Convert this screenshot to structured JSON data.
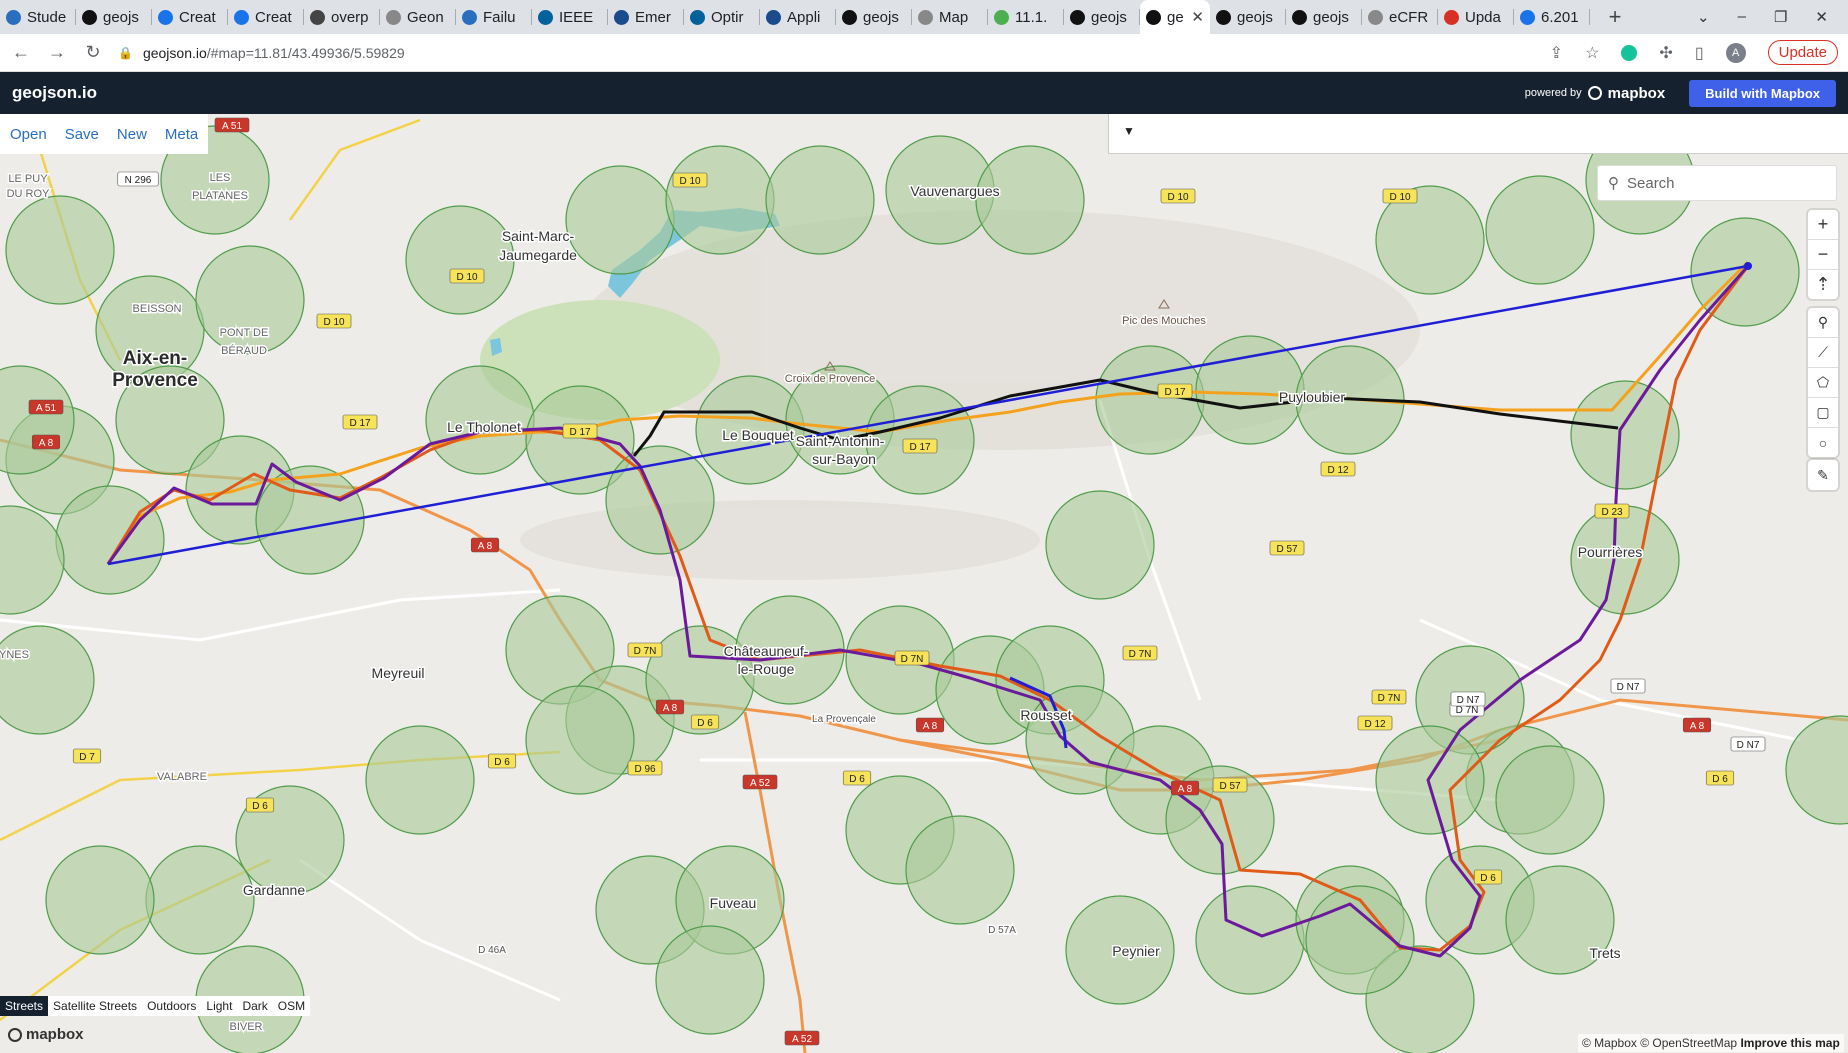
{
  "tabs": [
    {
      "label": "Stude",
      "icon": "app-icon",
      "color": "#2a6ec0"
    },
    {
      "label": "geojs",
      "icon": "geojson-icon",
      "color": "#111"
    },
    {
      "label": "Creat",
      "icon": "docs-icon",
      "color": "#1a73e8"
    },
    {
      "label": "Creat",
      "icon": "docs-icon",
      "color": "#1a73e8"
    },
    {
      "label": "overp",
      "icon": "overpass-icon",
      "color": "#444"
    },
    {
      "label": "Geon",
      "icon": "globe-icon",
      "color": "#888"
    },
    {
      "label": "Failu",
      "icon": "mail-icon",
      "color": "#2a6ec0"
    },
    {
      "label": "IEEE",
      "icon": "ieee-icon",
      "color": "#00629b"
    },
    {
      "label": "Emer",
      "icon": "emergency-icon",
      "color": "#1a4b8c"
    },
    {
      "label": "Optir",
      "icon": "ieee-icon",
      "color": "#00629b"
    },
    {
      "label": "Appli",
      "icon": "emergency-icon",
      "color": "#1a4b8c"
    },
    {
      "label": "geojs",
      "icon": "geojson-icon",
      "color": "#111"
    },
    {
      "label": "Map",
      "icon": "globe-icon",
      "color": "#888"
    },
    {
      "label": "11.1.",
      "icon": "qgis-icon",
      "color": "#4caf50"
    },
    {
      "label": "geojs",
      "icon": "geojson-icon",
      "color": "#111"
    },
    {
      "label": "ge",
      "icon": "geojson-icon",
      "color": "#111",
      "active": true
    },
    {
      "label": "geojs",
      "icon": "geojson-icon",
      "color": "#111"
    },
    {
      "label": "geojs",
      "icon": "geojson-icon",
      "color": "#111"
    },
    {
      "label": "eCFR",
      "icon": "globe-icon",
      "color": "#888"
    },
    {
      "label": "Upda",
      "icon": "gmail-icon",
      "color": "#d93025"
    },
    {
      "label": "6.201",
      "icon": "doc-icon",
      "color": "#1a73e8"
    }
  ],
  "browser": {
    "url_host": "geojson.io",
    "url_path": "/#map=11.81/43.49936/5.59829",
    "update_label": "Update",
    "avatar_letter": "A"
  },
  "app": {
    "brand": "geojson.io",
    "powered_by": "powered by",
    "mapbox": "mapbox",
    "build_button": "Build with Mapbox"
  },
  "menu": {
    "open": "Open",
    "save": "Save",
    "new": "New",
    "meta": "Meta"
  },
  "search": {
    "placeholder": "Search"
  },
  "layers": [
    "Streets",
    "Satellite Streets",
    "Outdoors",
    "Light",
    "Dark",
    "OSM"
  ],
  "selected_layer": "Streets",
  "attribution": {
    "mapbox": "© Mapbox",
    "osm": "© OpenStreetMap",
    "improve": "Improve this map"
  },
  "map_labels": [
    {
      "text": "Aix-en-",
      "cls": "city"
    },
    {
      "text": "Provence",
      "cls": "city"
    },
    {
      "text": "Saint-Marc-",
      "cls": "town"
    },
    {
      "text": "Jaumegarde",
      "cls": "town"
    },
    {
      "text": "Vauvenargues",
      "cls": "town"
    },
    {
      "text": "Le Tholonet",
      "cls": "town"
    },
    {
      "text": "Le Bouquet",
      "cls": "town"
    },
    {
      "text": "Saint-Antonin-",
      "cls": "town"
    },
    {
      "text": "sur-Bayon",
      "cls": "town"
    },
    {
      "text": "Puyloubier",
      "cls": "town"
    },
    {
      "text": "Pic des Mouches",
      "cls": "poi"
    },
    {
      "text": "Croix de Provence",
      "cls": "poi"
    },
    {
      "text": "Meyreuil",
      "cls": "town"
    },
    {
      "text": "Châteauneuf-",
      "cls": "town"
    },
    {
      "text": "le-Rouge",
      "cls": "town"
    },
    {
      "text": "Rousset",
      "cls": "town"
    },
    {
      "text": "Pourrières",
      "cls": "town"
    },
    {
      "text": "Gardanne",
      "cls": "town"
    },
    {
      "text": "Fuveau",
      "cls": "town"
    },
    {
      "text": "Peynier",
      "cls": "town"
    },
    {
      "text": "Trets",
      "cls": "town"
    },
    {
      "text": "BEISSON",
      "cls": "area"
    },
    {
      "text": "LES",
      "cls": "area"
    },
    {
      "text": "PLATANES",
      "cls": "area"
    },
    {
      "text": "PONT DE",
      "cls": "area"
    },
    {
      "text": "BÉRAUD",
      "cls": "area"
    },
    {
      "text": "LE PUY",
      "cls": "area"
    },
    {
      "text": "DU ROY",
      "cls": "area"
    },
    {
      "text": "VALABRE",
      "cls": "area"
    },
    {
      "text": "BIVER",
      "cls": "area"
    },
    {
      "text": "YNES",
      "cls": "area"
    },
    {
      "text": "La Provençale",
      "cls": "road"
    },
    {
      "text": "D 46A",
      "cls": "road"
    },
    {
      "text": "D 57A",
      "cls": "road"
    }
  ],
  "road_shields": [
    {
      "text": "A 51",
      "kind": "motorway"
    },
    {
      "text": "A 51",
      "kind": "motorway"
    },
    {
      "text": "A 8",
      "kind": "motorway"
    },
    {
      "text": "A 8",
      "kind": "motorway"
    },
    {
      "text": "A 8",
      "kind": "motorway"
    },
    {
      "text": "A 8",
      "kind": "motorway"
    },
    {
      "text": "A 8",
      "kind": "motorway"
    },
    {
      "text": "A 8",
      "kind": "motorway"
    },
    {
      "text": "A 52",
      "kind": "motorway"
    },
    {
      "text": "A 52",
      "kind": "motorway"
    },
    {
      "text": "D 10",
      "kind": "dept"
    },
    {
      "text": "D 10",
      "kind": "dept"
    },
    {
      "text": "D 10",
      "kind": "dept"
    },
    {
      "text": "D 10",
      "kind": "dept"
    },
    {
      "text": "D 10",
      "kind": "dept"
    },
    {
      "text": "D 17",
      "kind": "dept"
    },
    {
      "text": "D 17",
      "kind": "dept"
    },
    {
      "text": "D 17",
      "kind": "dept"
    },
    {
      "text": "D 17",
      "kind": "dept"
    },
    {
      "text": "D 12",
      "kind": "dept"
    },
    {
      "text": "D 12",
      "kind": "dept"
    },
    {
      "text": "D 57",
      "kind": "dept"
    },
    {
      "text": "D 57",
      "kind": "dept"
    },
    {
      "text": "D 7N",
      "kind": "dept"
    },
    {
      "text": "D 7N",
      "kind": "dept"
    },
    {
      "text": "D 7N",
      "kind": "dept"
    },
    {
      "text": "D 7N",
      "kind": "dept"
    },
    {
      "text": "D 7N",
      "kind": "white"
    },
    {
      "text": "D N7",
      "kind": "white"
    },
    {
      "text": "D N7",
      "kind": "white"
    },
    {
      "text": "D N7",
      "kind": "white"
    },
    {
      "text": "N 296",
      "kind": "white"
    },
    {
      "text": "D 6",
      "kind": "dept"
    },
    {
      "text": "D 6",
      "kind": "dept"
    },
    {
      "text": "D 6",
      "kind": "dept"
    },
    {
      "text": "D 6",
      "kind": "dept"
    },
    {
      "text": "D 6",
      "kind": "dept"
    },
    {
      "text": "D 6",
      "kind": "dept"
    },
    {
      "text": "D 7",
      "kind": "dept"
    },
    {
      "text": "D 96",
      "kind": "dept"
    },
    {
      "text": "D 23",
      "kind": "dept"
    }
  ],
  "colors": {
    "buffer_fill": "#a9c99a",
    "buffer_stroke": "#4f9c4a",
    "line_blue": "#1f1fd6",
    "line_orange": "#f4a21e",
    "line_black": "#111111",
    "line_purple": "#6a1a9a",
    "line_redorange": "#e05a18"
  }
}
